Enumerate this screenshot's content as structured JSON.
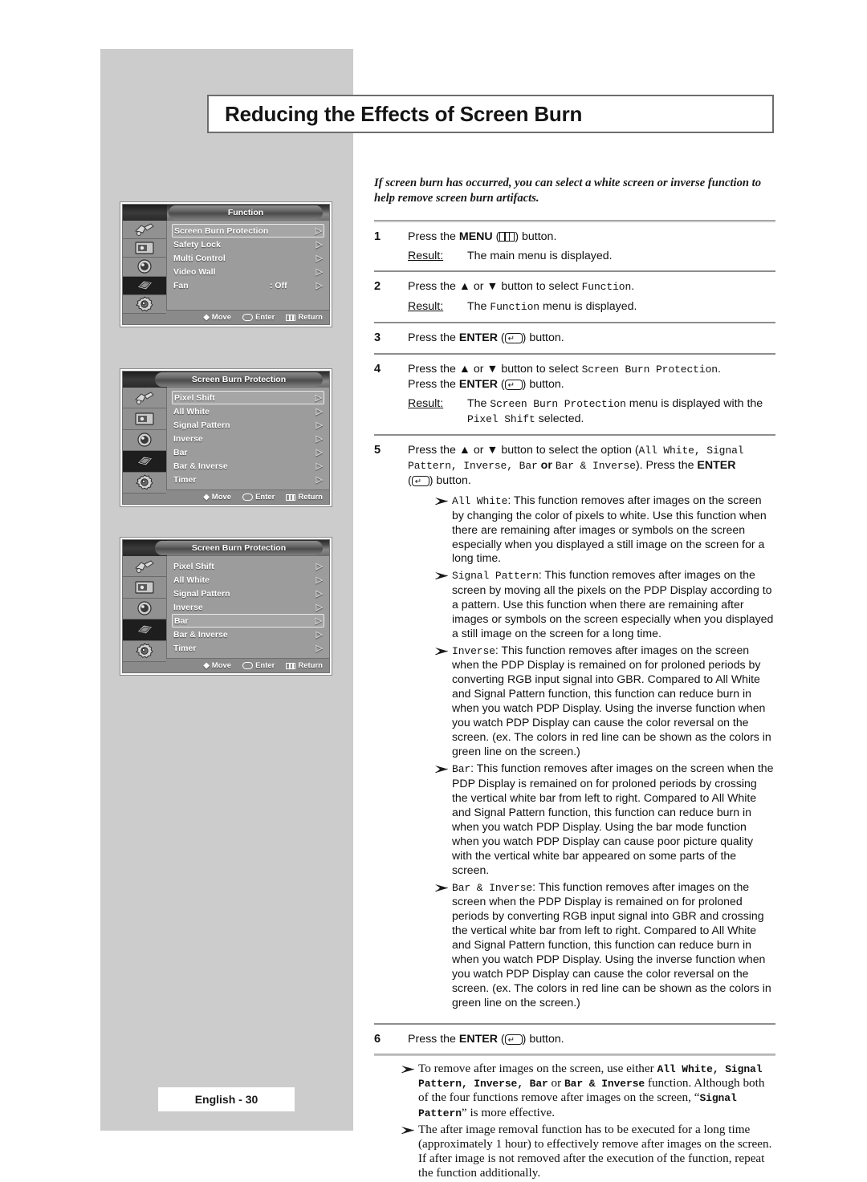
{
  "page": {
    "header_title": "Reducing the Effects of Screen Burn",
    "footer_label": "English - 30",
    "intro": "If screen burn has occurred, you can select a white screen or inverse function to help remove screen burn artifacts."
  },
  "osd_screens": [
    {
      "title": "Function",
      "icons": [
        "input-source-icon",
        "picture-icon",
        "sound-icon",
        "function-chip-icon",
        "setup-gear-icon"
      ],
      "active_icon_index": 3,
      "rows": [
        {
          "label": "Screen Burn Protection",
          "value": "",
          "selected": true,
          "arrow": "▷"
        },
        {
          "label": "Safety Lock",
          "value": "",
          "selected": false,
          "arrow": "▷"
        },
        {
          "label": "Multi Control",
          "value": "",
          "selected": false,
          "arrow": "▷"
        },
        {
          "label": "Video Wall",
          "value": "",
          "selected": false,
          "arrow": "▷"
        },
        {
          "label": "Fan",
          "value": ": Off",
          "selected": false,
          "arrow": "▷"
        }
      ],
      "footer": {
        "move": "Move",
        "enter": "Enter",
        "return": "Return"
      }
    },
    {
      "title": "Screen Burn Protection",
      "icons": [
        "input-source-icon",
        "picture-icon",
        "sound-icon",
        "function-chip-icon",
        "setup-gear-icon"
      ],
      "active_icon_index": 3,
      "rows": [
        {
          "label": "Pixel Shift",
          "value": "",
          "selected": true,
          "arrow": "▷"
        },
        {
          "label": "All White",
          "value": "",
          "selected": false,
          "arrow": "▷"
        },
        {
          "label": "Signal Pattern",
          "value": "",
          "selected": false,
          "arrow": "▷"
        },
        {
          "label": "Inverse",
          "value": "",
          "selected": false,
          "arrow": "▷"
        },
        {
          "label": "Bar",
          "value": "",
          "selected": false,
          "arrow": "▷"
        },
        {
          "label": "Bar & Inverse",
          "value": "",
          "selected": false,
          "arrow": "▷"
        },
        {
          "label": "Timer",
          "value": "",
          "selected": false,
          "arrow": "▷"
        }
      ],
      "footer": {
        "move": "Move",
        "enter": "Enter",
        "return": "Return"
      }
    },
    {
      "title": "Screen Burn Protection",
      "icons": [
        "input-source-icon",
        "picture-icon",
        "sound-icon",
        "function-chip-icon",
        "setup-gear-icon"
      ],
      "active_icon_index": 3,
      "rows": [
        {
          "label": "Pixel Shift",
          "value": "",
          "selected": false,
          "arrow": "▷"
        },
        {
          "label": "All White",
          "value": "",
          "selected": false,
          "arrow": "▷"
        },
        {
          "label": "Signal Pattern",
          "value": "",
          "selected": false,
          "arrow": "▷"
        },
        {
          "label": "Inverse",
          "value": "",
          "selected": false,
          "arrow": "▷"
        },
        {
          "label": "Bar",
          "value": "",
          "selected": true,
          "arrow": "▷"
        },
        {
          "label": "Bar & Inverse",
          "value": "",
          "selected": false,
          "arrow": "▷"
        },
        {
          "label": "Timer",
          "value": "",
          "selected": false,
          "arrow": "▷"
        }
      ],
      "footer": {
        "move": "Move",
        "enter": "Enter",
        "return": "Return"
      }
    }
  ],
  "steps": {
    "s1": {
      "num": "1",
      "pre": "Press the ",
      "key": "MENU",
      "post": " button.",
      "result_label": "Result:",
      "result_text": "The main menu is displayed."
    },
    "s2": {
      "num": "2",
      "pre": "Press the ▲ or ▼ button to select ",
      "mono": "Function",
      "post": ".",
      "result_label": "Result:",
      "result_pre": "The ",
      "result_mono": "Function",
      "result_post": " menu is displayed."
    },
    "s3": {
      "num": "3",
      "pre": "Press the ",
      "key": "ENTER",
      "post": " button."
    },
    "s4": {
      "num": "4",
      "l1_pre": "Press the ▲ or ▼ button to select ",
      "l1_mono": "Screen Burn Protection",
      "l1_post": ".",
      "l2_pre": "Press the ",
      "l2_key": "ENTER",
      "l2_post": " button.",
      "result_label": "Result:",
      "result_pre": "The ",
      "result_mono1": "Screen Burn Protection",
      "result_mid": " menu is displayed with the ",
      "result_mono2": "Pixel Shift",
      "result_post": " selected."
    },
    "s5": {
      "num": "5",
      "pre": "Press the ▲ or ▼ button to select the option (",
      "mono_opts": "All White, Signal Pattern, Inverse, Bar",
      "mid": " or ",
      "mono_opts2": "Bar & Inverse",
      "post": "). Press the ",
      "key": "ENTER",
      "tail": " button."
    },
    "s6": {
      "num": "6",
      "pre": "Press the ",
      "key": "ENTER",
      "post": " button."
    }
  },
  "option_bullets": [
    {
      "term": "All White",
      "text": ": This function removes after images on the screen by changing the color of pixels to white. Use this function when there are remaining after images or symbols on the screen especially when you displayed a still image on the screen for a long time."
    },
    {
      "term": "Signal Pattern",
      "text": ": This function removes after images on the screen by moving all the pixels on the PDP Display according to a pattern. Use this function when there are remaining after images or symbols on the screen especially when you displayed a still image on the screen for a long time."
    },
    {
      "term": "Inverse",
      "text": ": This function removes after images on the screen when the PDP Display is remained on for proloned periods by converting RGB input signal into GBR. Compared to All White and Signal Pattern function, this function can reduce burn in when you watch PDP Display. Using the inverse function when you watch PDP Display can cause the color reversal on the screen. (ex. The colors in red line can be shown as the colors in green line on the screen.)"
    },
    {
      "term": "Bar",
      "text": ": This function removes after images on the screen when the PDP Display is remained on for proloned periods by crossing the vertical white bar from left to right. Compared to All White and Signal Pattern function, this function can reduce burn in when you watch PDP Display. Using the bar mode function when you watch PDP Display can cause poor picture quality  with the vertical white bar appeared on some parts of the screen."
    },
    {
      "term": "Bar & Inverse",
      "text": ": This function removes after images on the screen when the PDP Display is remained on for proloned periods by converting RGB input signal into GBR and crossing the vertical white bar from left to right. Compared to All White and Signal Pattern function, this function can reduce burn in when you watch PDP Display. Using the inverse function when you watch PDP Display can cause the color reversal on the screen. (ex. The colors in red line can be shown as the colors in green line on the screen.)"
    }
  ],
  "end_notes": [
    {
      "p1": "To remove after images on the screen, use either ",
      "m1": "All White, Signal Pattern, Inverse, Bar",
      "p2": " or ",
      "m2": "Bar & Inverse",
      "p3": " function. Although both of the four functions remove after images on the screen, “",
      "m3": "Signal Pattern",
      "p4": "” is more effective."
    },
    {
      "plain": "The after image removal function has to be executed for a long time (approximately 1 hour) to effectively remove after images on the screen. If after image is not removed after the execution of the function, repeat the function additionally."
    }
  ]
}
